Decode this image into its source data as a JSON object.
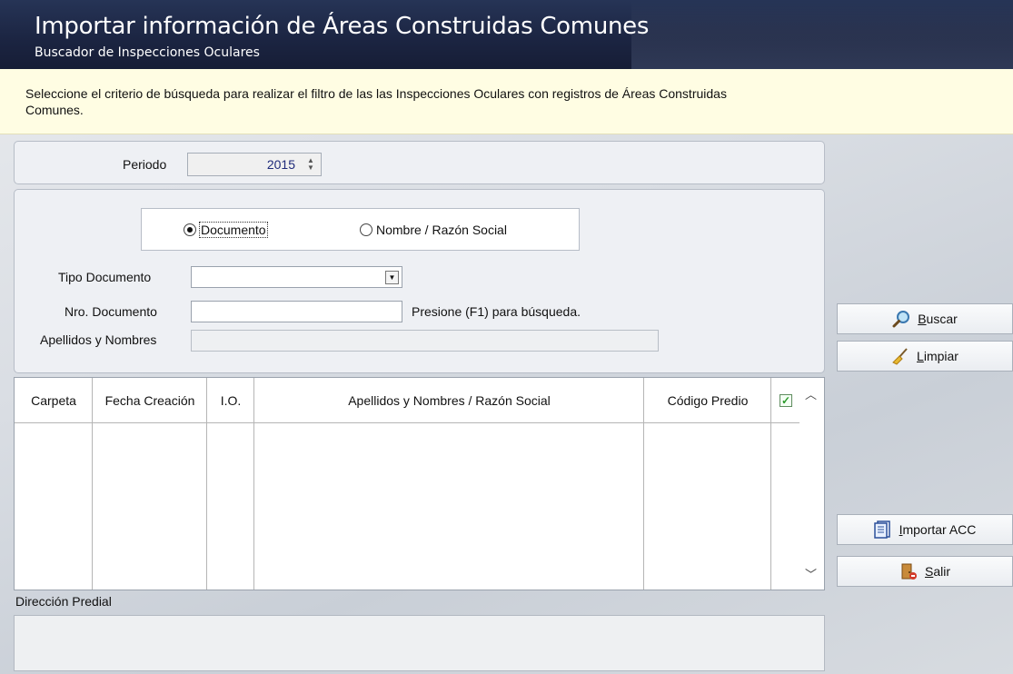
{
  "header": {
    "title": "Importar información de Áreas Construidas Comunes",
    "subtitle": "Buscador de Inspecciones Oculares"
  },
  "info": {
    "line1": "Seleccione el criterio de búsqueda para realizar el filtro de las las Inspecciones Oculares con registros de Áreas Construidas",
    "line2": "Comunes."
  },
  "periodo": {
    "label": "Periodo",
    "value": "2015"
  },
  "search_mode": {
    "option1": "Documento",
    "option2": "Nombre / Razón Social",
    "selected": "Documento"
  },
  "form": {
    "tipo_label": "Tipo  Documento",
    "tipo_value": "",
    "nro_label": "Nro. Documento",
    "nro_value": "",
    "hint": "Presione (F1) para búsqueda.",
    "apellidos_label": "Apellidos y Nombres",
    "apellidos_value": ""
  },
  "grid": {
    "columns": [
      "Carpeta",
      "Fecha Creación",
      "I.O.",
      "Apellidos y Nombres / Razón Social",
      "Código Predio"
    ],
    "rows": []
  },
  "buttons": {
    "buscar": {
      "underline": "B",
      "rest": "uscar"
    },
    "limpiar": {
      "underline": "L",
      "rest": "impiar"
    },
    "importar": {
      "underline": "I",
      "rest": "mportar ACC"
    },
    "salir": {
      "underline": "S",
      "rest": "alir"
    }
  },
  "direccion": {
    "label": "Dirección Predial",
    "value": ""
  },
  "colors": {
    "header_bg": "#1b2441",
    "info_bg": "#fffde3",
    "panel_bg": "#eef0f4"
  }
}
